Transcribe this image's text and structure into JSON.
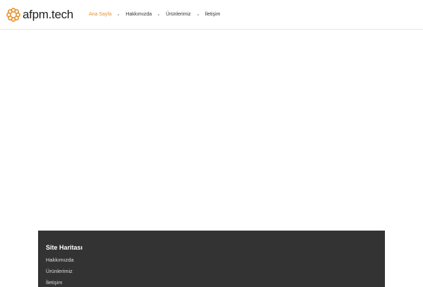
{
  "header": {
    "logo_text": "afpm.tech",
    "nav": [
      "Ana Sayfa",
      "Hakkımızda",
      "Ürünlerimiz",
      "İletişim"
    ]
  },
  "footer": {
    "title": "Site Haritası",
    "links": [
      "Hakkımızda",
      "Ürünlerimiz",
      "İletişim"
    ]
  },
  "colors": {
    "accent": "#e8912c",
    "footer_bg": "#333333"
  }
}
